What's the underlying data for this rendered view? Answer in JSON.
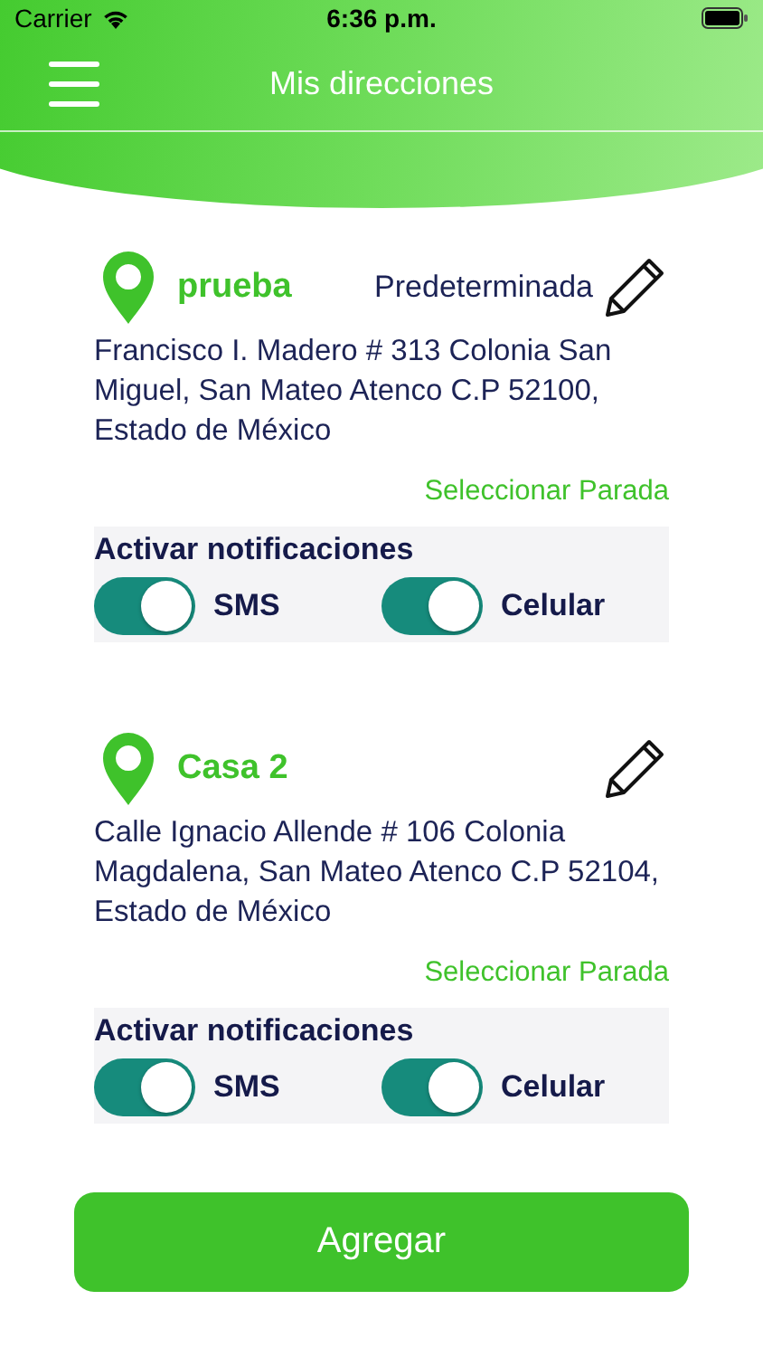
{
  "status_bar": {
    "carrier": "Carrier",
    "time": "6:36 p.m."
  },
  "nav": {
    "title": "Mis direcciones"
  },
  "addresses": [
    {
      "name": "prueba",
      "default_label": "Predeterminada",
      "address": "Francisco I. Madero # 313 Colonia San Miguel, San Mateo Atenco C.P 52100, Estado de México",
      "select_link": "Seleccionar Parada",
      "notifications_title": "Activar notificaciones",
      "toggles": [
        {
          "label": "SMS",
          "on": true
        },
        {
          "label": "Celular",
          "on": true
        }
      ]
    },
    {
      "name": "Casa 2",
      "address": "Calle Ignacio Allende # 106 Colonia Magdalena, San Mateo Atenco C.P 52104, Estado de México",
      "select_link": "Seleccionar Parada",
      "notifications_title": "Activar notificaciones",
      "toggles": [
        {
          "label": "SMS",
          "on": true
        },
        {
          "label": "Celular",
          "on": true
        }
      ]
    }
  ],
  "add_button": "Agregar"
}
